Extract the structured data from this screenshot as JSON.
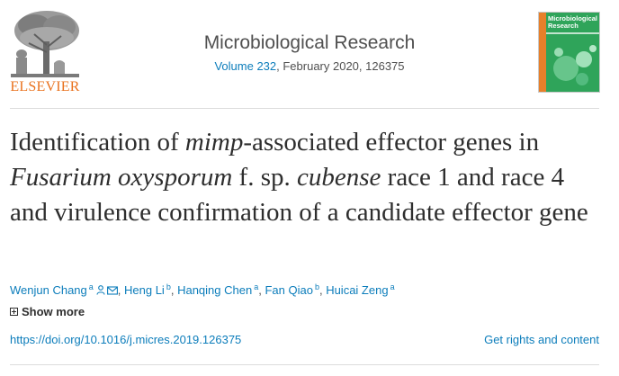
{
  "publisher": {
    "logo_text": "ELSEVIER"
  },
  "journal": {
    "title": "Microbiological Research",
    "volume_link": "Volume 232",
    "meta_rest": ", February 2020, 126375",
    "cover_title": "Microbiological Research"
  },
  "article": {
    "title_parts": [
      {
        "text": "Identification of ",
        "italic": false
      },
      {
        "text": "mimp",
        "italic": true
      },
      {
        "text": "-associated effector genes in ",
        "italic": false
      },
      {
        "text": "Fusarium oxysporum",
        "italic": true
      },
      {
        "text": " f. sp. ",
        "italic": false
      },
      {
        "text": "cubense",
        "italic": true
      },
      {
        "text": " race 1 and race 4 and virulence confirmation of a candidate effector gene",
        "italic": false
      }
    ]
  },
  "authors": [
    {
      "name": "Wenjun Chang",
      "aff": "a",
      "icons": true
    },
    {
      "name": "Heng Li",
      "aff": "b",
      "icons": false
    },
    {
      "name": "Hanqing Chen",
      "aff": "a",
      "icons": false
    },
    {
      "name": "Fan Qiao",
      "aff": "b",
      "icons": false
    },
    {
      "name": "Huicai Zeng",
      "aff": "a",
      "icons": false
    }
  ],
  "show_more_label": "Show more",
  "doi": "https://doi.org/10.1016/j.micres.2019.126375",
  "rights_label": "Get rights and content",
  "colors": {
    "link": "#0c7dbb",
    "brand_orange": "#e9711c",
    "cover_green": "#2fa45a"
  },
  "icons": {
    "author_person": "person-icon",
    "author_email": "envelope-icon",
    "show_more": "plus-box-icon"
  }
}
